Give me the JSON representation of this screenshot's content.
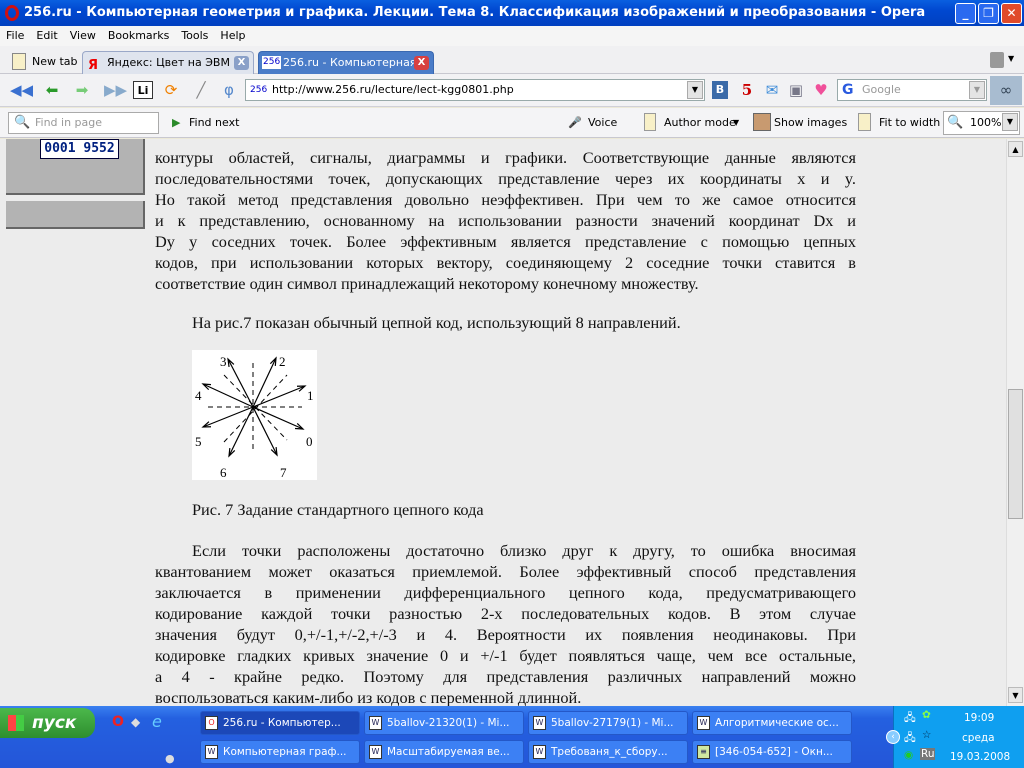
{
  "window": {
    "title": "256.ru - Компьютерная геометрия и графика. Лекции. Тема 8. Классификация изображений и преобразования - Opera",
    "controls": [
      "_",
      "❐",
      "✕"
    ]
  },
  "menu": [
    "File",
    "Edit",
    "View",
    "Bookmarks",
    "Tools",
    "Help"
  ],
  "tabs": [
    {
      "label": "New tab"
    },
    {
      "label": "Яндекс: Цвет на ЭВМ"
    },
    {
      "label": "256.ru - Компьютерная..."
    }
  ],
  "address": {
    "favicon": "256",
    "url": "http://www.256.ru/lecture/lect-kgg0801.php"
  },
  "search": {
    "placeholder": "Google"
  },
  "findbar": {
    "find_placeholder": "Find in page",
    "find_next": "Find next",
    "voice": "Voice",
    "author_mode": "Author mode",
    "show_images": "Show images",
    "fit_to_width": "Fit to width",
    "zoom": "100%"
  },
  "sidebar": {
    "counter": "0001 9552"
  },
  "article": {
    "para1": [
      "контуры областей, сигналы, диаграммы и графики. Соответствующие данные являются",
      "последовательностями точек, допускающих представление через их координаты x и y.",
      "Но такой метод представления довольно неэффективен. При чем то же самое относится",
      "и к представлению, основанному на использовании разности значений координат Dx и",
      "Dy у соседних точек. Более эффективным является представление с помощью цепных",
      "кодов, при использовании которых вектору, соединяющему 2 соседние точки ставится в",
      "соответствие один символ принадлежащий некоторому конечному множеству."
    ],
    "para2": "На рис.7 показан обычный цепной код, использующий 8 направлений.",
    "figure_labels": [
      "0",
      "1",
      "2",
      "3",
      "4",
      "5",
      "6",
      "7"
    ],
    "caption": "Рис. 7 Задание стандартного цепного кода",
    "para3": [
      "Если точки расположены достаточно близко друг к другу, то ошибка вносимая",
      "квантованием может оказаться приемлемой. Более эффективный способ представления",
      "заключается в применении дифференциального цепного кода, предусматривающего",
      "кодирование каждой точки разностью 2-х последовательных кодов. В этом случае",
      "значения будут 0,+/-1,+/-2,+/-3 и 4. Вероятности их появления неодинаковы. При",
      "кодировке гладких кривых значение 0 и +/-1 будет появляться чаще, чем все остальные,",
      "а 4 - крайне редко. Поэтому для представления различных направлений можно",
      "воспользоваться каким-либо из кодов с переменной длинной."
    ]
  },
  "taskbar": {
    "start": "пуск",
    "row1": [
      "256.ru - Компьютер...",
      "5ballov-21320(1) - Mi...",
      "5ballov-27179(1) - Mi...",
      "Алгоритмические ос..."
    ],
    "row2": [
      "Компьютерная граф...",
      "Масштабируемая ве...",
      "Требованя_к_сбору...",
      "[346-054-652] - Окн..."
    ],
    "clock": {
      "time": "19:09",
      "day": "среда",
      "date": "19.03.2008"
    },
    "lang": "Ru"
  }
}
